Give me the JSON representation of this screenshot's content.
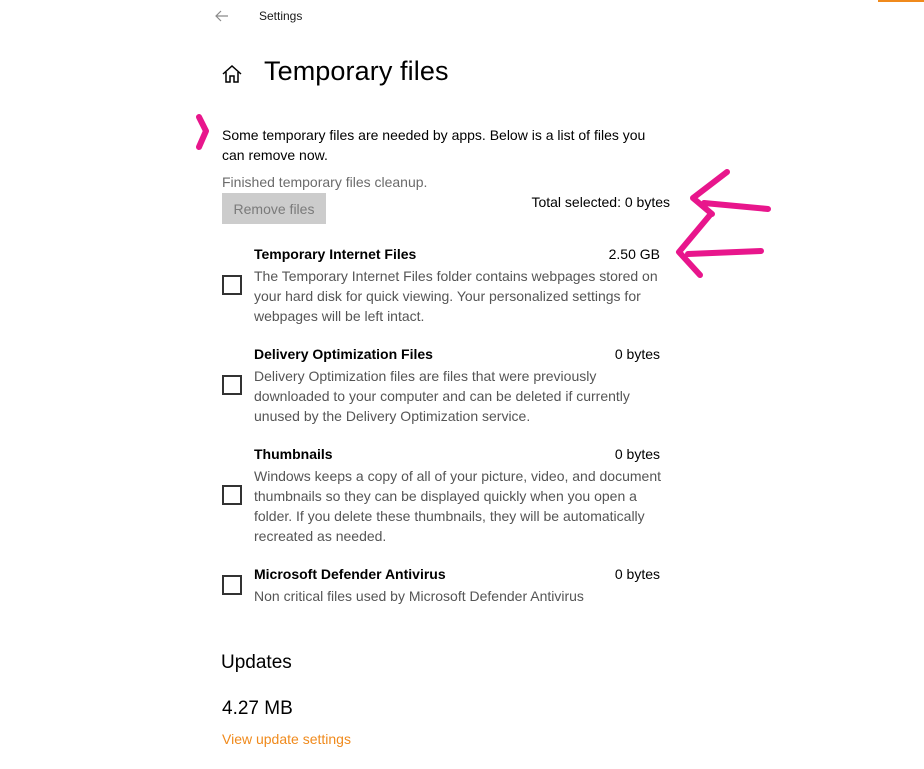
{
  "window": {
    "title": "Settings",
    "accent_color": "#f08a1c"
  },
  "header": {
    "title": "Temporary files"
  },
  "intro": "Some temporary files are needed by apps. Below is a list of files you can remove now.",
  "status": "Finished temporary files cleanup.",
  "remove_button": "Remove files",
  "total_selected": "Total selected: 0 bytes",
  "files": [
    {
      "name": "Temporary Internet Files",
      "size": "2.50 GB",
      "description": "The Temporary Internet Files folder contains webpages stored on your hard disk for quick viewing. Your personalized settings for webpages will be left intact.",
      "checked": false
    },
    {
      "name": "Delivery Optimization Files",
      "size": "0 bytes",
      "description": "Delivery Optimization files are files that were previously downloaded to your computer and can be deleted if currently unused by the Delivery Optimization service.",
      "checked": false
    },
    {
      "name": "Thumbnails",
      "size": "0 bytes",
      "description": "Windows keeps a copy of all of your picture, video, and document thumbnails so they can be displayed quickly when you open a folder. If you delete these thumbnails, they will be automatically recreated as needed.",
      "checked": false
    },
    {
      "name": "Microsoft Defender Antivirus",
      "size": "0 bytes",
      "description": "Non critical files used by Microsoft Defender Antivirus",
      "checked": false
    }
  ],
  "updates": {
    "heading": "Updates",
    "size": "4.27 MB",
    "link": "View update settings"
  },
  "icons": {
    "back": "back-arrow-icon",
    "home": "home-icon"
  },
  "annotation_color": "#e8168c"
}
